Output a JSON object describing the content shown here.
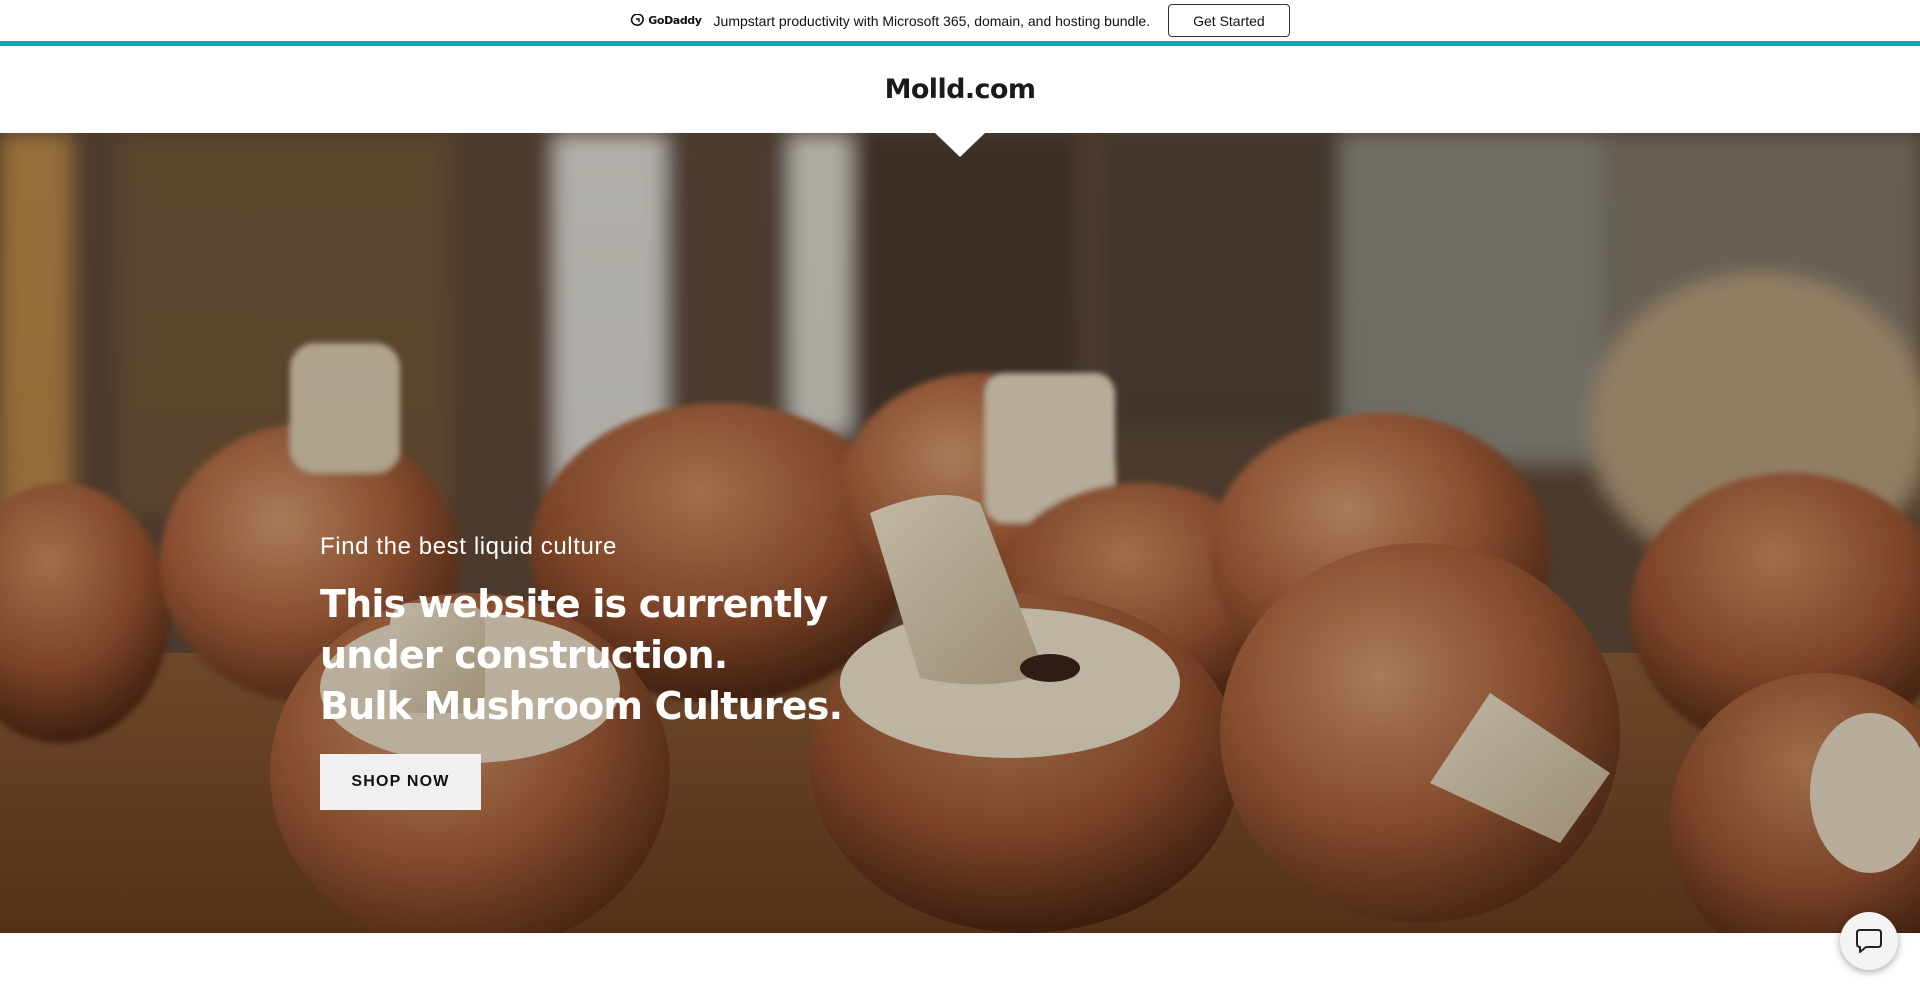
{
  "promo": {
    "logo_text": "GoDaddy",
    "message": "Jumpstart productivity with Microsoft 365, domain, and hosting bundle.",
    "cta_label": "Get Started",
    "accent_color": "#1ba3b4"
  },
  "header": {
    "site_title": "Molld.com"
  },
  "hero": {
    "subtitle": "Find the best liquid culture",
    "title_lines": [
      "This website is currently",
      "under construction.",
      "Bulk Mushroom Cultures."
    ],
    "cta_label": "SHOP NOW",
    "background_image": "mushrooms-on-wooden-board"
  },
  "chat": {
    "icon": "chat-bubble-icon"
  }
}
